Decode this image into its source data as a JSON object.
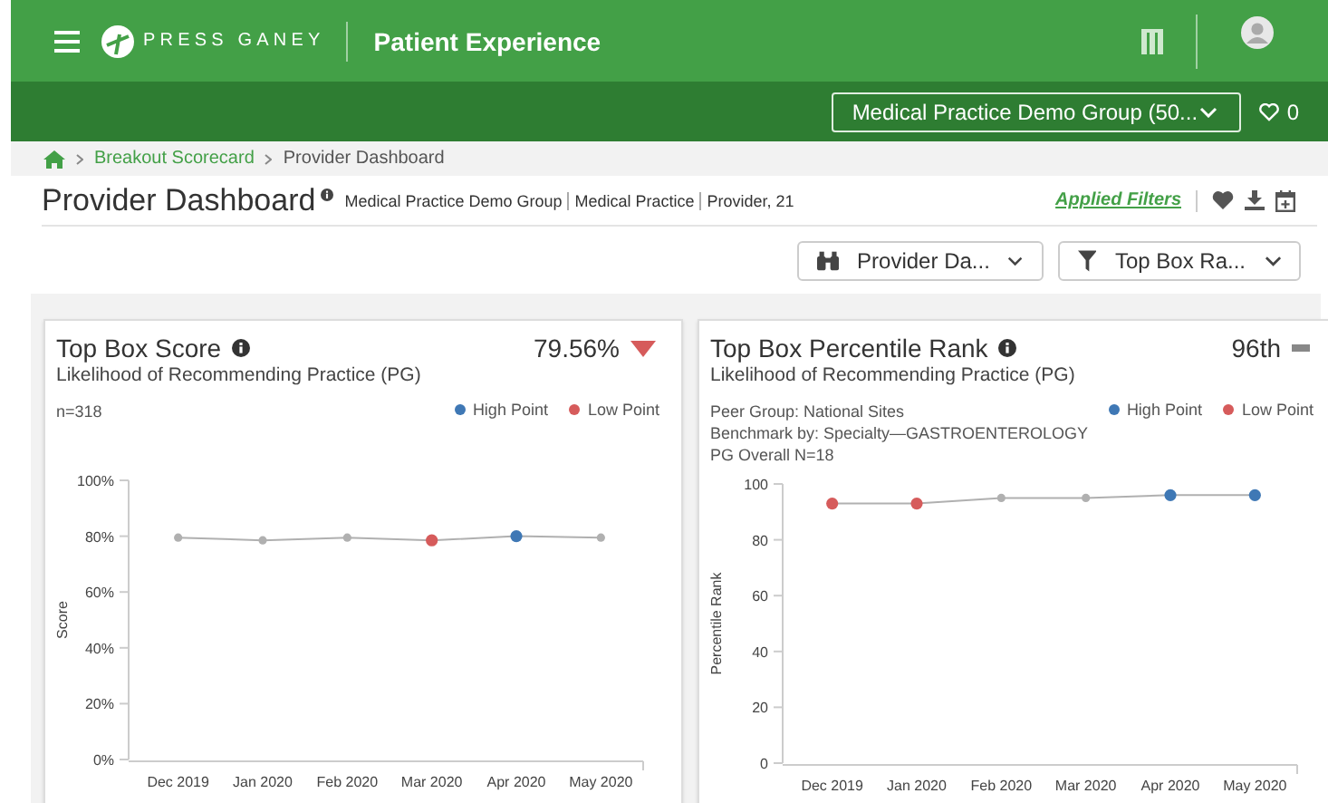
{
  "top_bar": {
    "brand": "PRESS GANEY",
    "product": "Patient Experience"
  },
  "org_bar": {
    "selector": "Medical Practice Demo Group (50...",
    "favorites_count": "0"
  },
  "breadcrumb": [
    "Breakout Scorecard",
    "Provider Dashboard"
  ],
  "header": {
    "title": "Provider Dashboard",
    "context": [
      "Medical Practice Demo Group",
      "Medical Practice",
      "Provider, 21"
    ],
    "applied_filters": "Applied Filters"
  },
  "filters": [
    {
      "kind": "view",
      "label": "Provider Da..."
    },
    {
      "kind": "filter",
      "label": "Top Box Ra..."
    }
  ],
  "cards": [
    {
      "title": "Top Box Score",
      "subtitle": "Likelihood of Recommending Practice (PG)",
      "value": "79.56%",
      "declined": true,
      "unchanged": false,
      "notes": [
        "n=318"
      ],
      "legend": [
        {
          "kind": "high",
          "label": "High Point",
          "color": "#3f78b5"
        },
        {
          "kind": "low",
          "label": "Low Point",
          "color": "#d65b5b"
        }
      ],
      "points": [
        {
          "high": false,
          "low": false
        },
        {
          "high": false,
          "low": false
        },
        {
          "high": false,
          "low": false
        },
        {
          "high": false,
          "low": true
        },
        {
          "high": true,
          "low": false
        },
        {
          "high": false,
          "low": false
        }
      ],
      "chart_data": {
        "type": "line",
        "ylabel": "Score",
        "categories": [
          "Dec 2019",
          "Jan 2020",
          "Feb 2020",
          "Mar 2020",
          "Apr 2020",
          "May 2020"
        ],
        "ylim": [
          0,
          100
        ],
        "yticks": [
          {
            "value": 0,
            "label": "0%"
          },
          {
            "value": 20,
            "label": "20%"
          },
          {
            "value": 40,
            "label": "40%"
          },
          {
            "value": 60,
            "label": "60%"
          },
          {
            "value": 80,
            "label": "80%"
          },
          {
            "value": 100,
            "label": "100%"
          }
        ],
        "series": [
          {
            "color": "#b0b0b0",
            "marker": true,
            "values": [
              79.5,
              78.5,
              79.5,
              78.5,
              80,
              79.5
            ]
          }
        ]
      }
    },
    {
      "title": "Top Box Percentile Rank",
      "subtitle": "Likelihood of Recommending Practice (PG)",
      "value": "96th",
      "declined": false,
      "unchanged": true,
      "notes": [
        "Peer Group: National Sites",
        "Benchmark by: Specialty—GASTROENTEROLOGY",
        "PG Overall N=18"
      ],
      "legend": [
        {
          "kind": "high",
          "label": "High Point",
          "color": "#3f78b5"
        },
        {
          "kind": "low",
          "label": "Low Point",
          "color": "#d65b5b"
        }
      ],
      "points": [
        {
          "high": false,
          "low": true
        },
        {
          "high": false,
          "low": true
        },
        {
          "high": false,
          "low": false
        },
        {
          "high": false,
          "low": false
        },
        {
          "high": true,
          "low": false
        },
        {
          "high": true,
          "low": false
        }
      ],
      "chart_data": {
        "type": "line",
        "ylabel": "Percentile Rank",
        "categories": [
          "Dec 2019",
          "Jan 2020",
          "Feb 2020",
          "Mar 2020",
          "Apr 2020",
          "May 2020"
        ],
        "ylim": [
          0,
          100
        ],
        "yticks": [
          0,
          20,
          40,
          60,
          80,
          100
        ],
        "series": [
          {
            "color": "#b0b0b0",
            "marker": true,
            "values": [
              93,
              93,
              95,
              95,
              96,
              96
            ]
          }
        ]
      }
    }
  ]
}
